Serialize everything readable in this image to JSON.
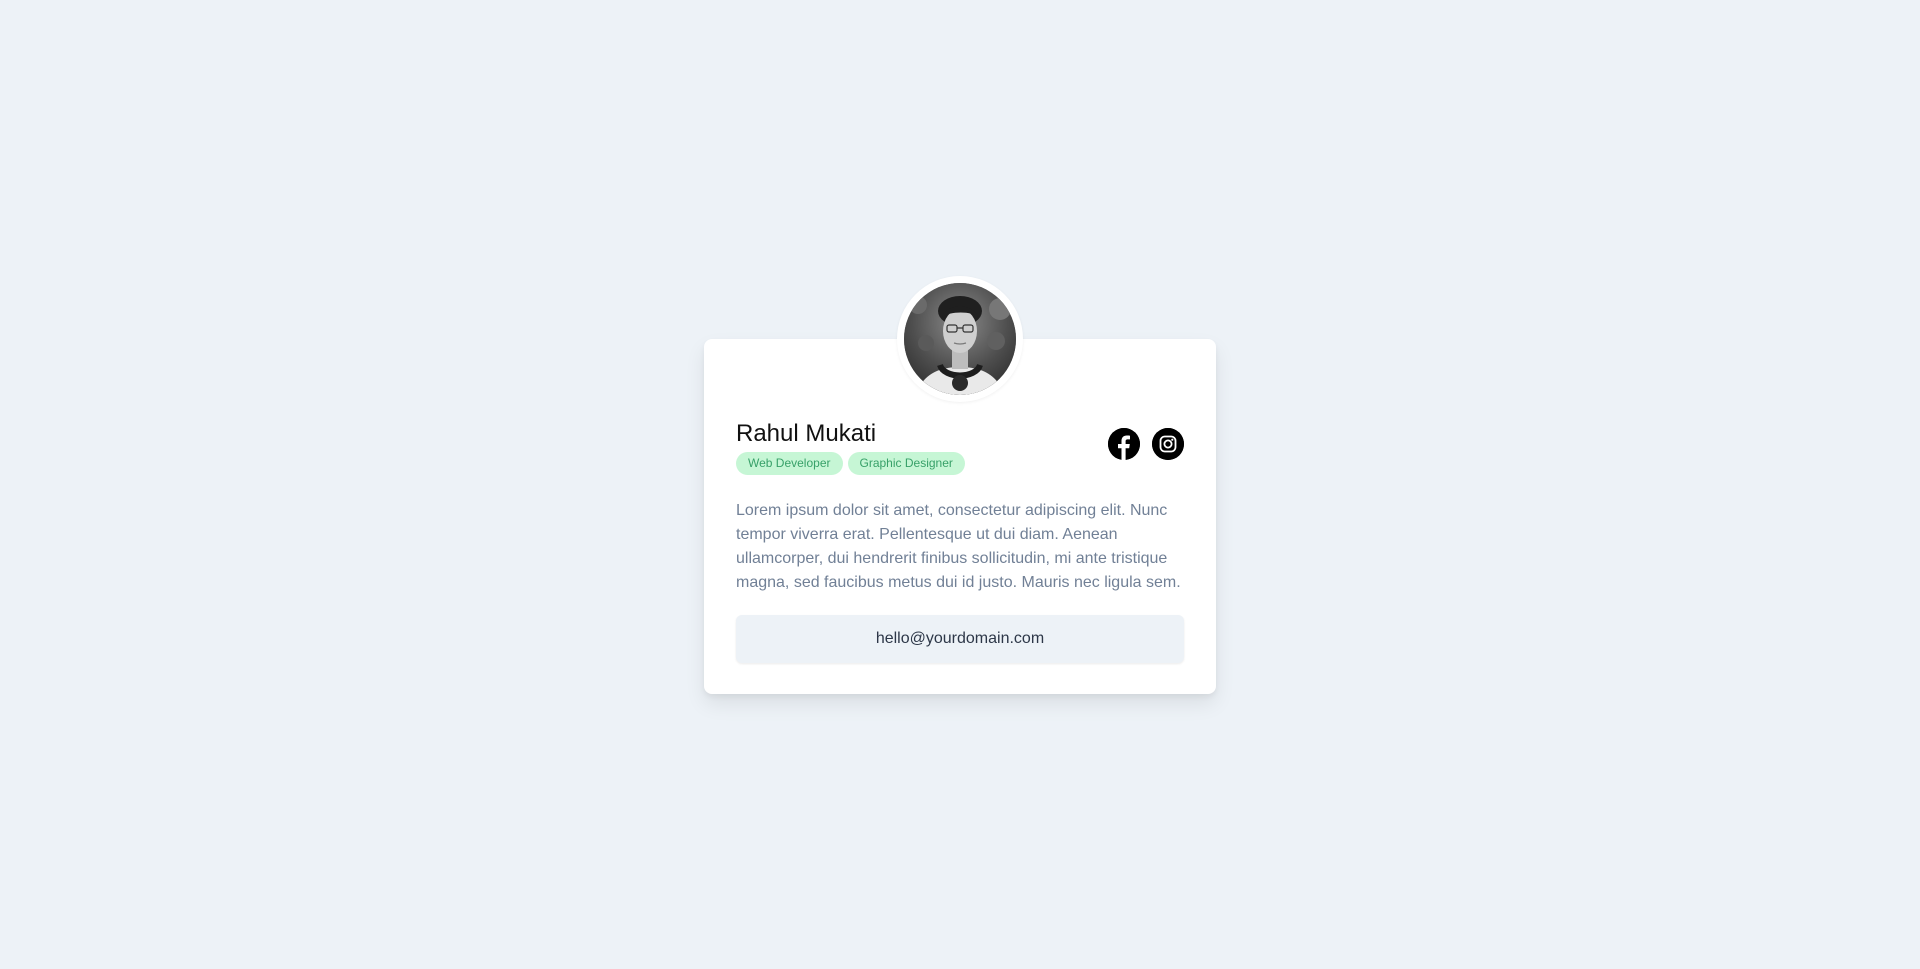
{
  "profile": {
    "name": "Rahul Mukati",
    "tags": [
      "Web Developer",
      "Graphic Designer"
    ],
    "bio": "Lorem ipsum dolor sit amet, consectetur adipiscing elit. Nunc tempor viverra erat. Pellentesque ut dui diam. Aenean ullamcorper, dui hendrerit finibus sollicitudin, mi ante tristique magna, sed faucibus metus dui id justo. Mauris nec ligula sem.",
    "email": "hello@yourdomain.com"
  },
  "socials": [
    {
      "icon": "facebook-icon"
    },
    {
      "icon": "instagram-icon"
    }
  ],
  "colors": {
    "background": "#edf2f7",
    "card": "#ffffff",
    "tag_bg": "#c6f6d5",
    "tag_text": "#38a169",
    "bio_text": "#718096",
    "button_bg": "#edf2f7"
  }
}
